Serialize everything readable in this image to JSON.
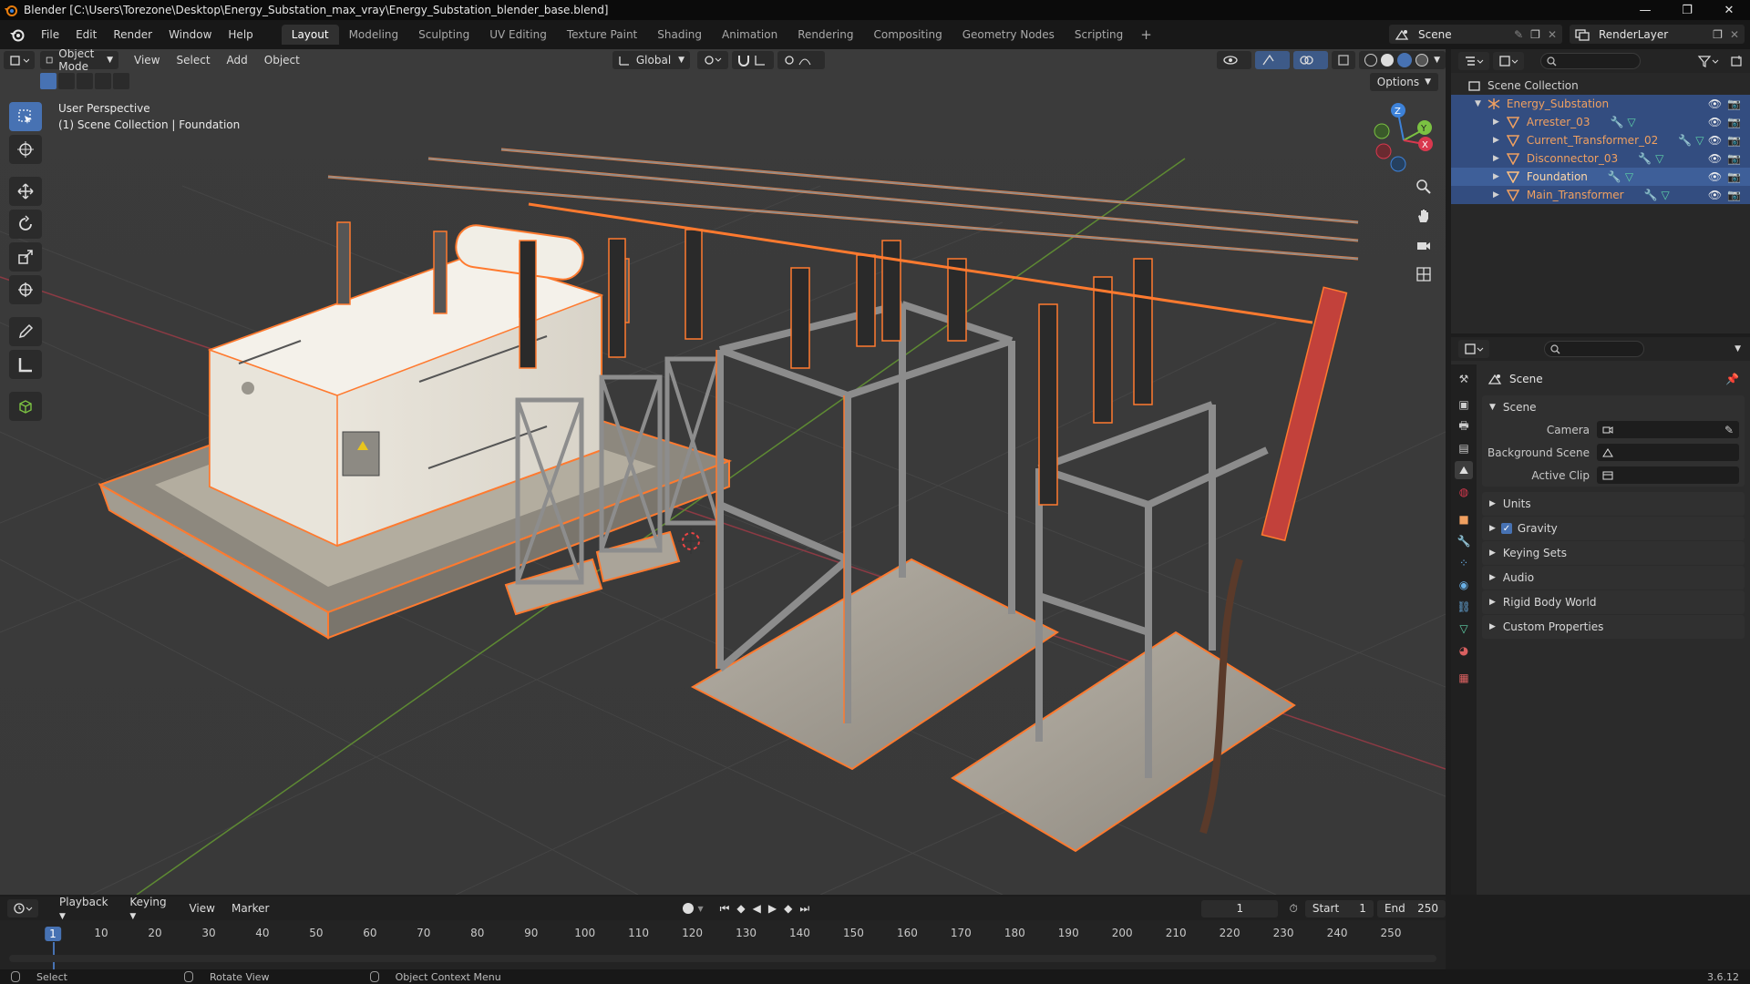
{
  "window": {
    "title": "Blender [C:\\Users\\Torezone\\Desktop\\Energy_Substation_max_vray\\Energy_Substation_blender_base.blend]",
    "controls": [
      "—",
      "❐",
      "✕"
    ]
  },
  "menubar": {
    "menus": [
      "File",
      "Edit",
      "Render",
      "Window",
      "Help"
    ],
    "workspaces": [
      "Layout",
      "Modeling",
      "Sculpting",
      "UV Editing",
      "Texture Paint",
      "Shading",
      "Animation",
      "Rendering",
      "Compositing",
      "Geometry Nodes",
      "Scripting"
    ],
    "active_workspace": "Layout",
    "add_workspace": "+",
    "scene_name": "Scene",
    "view_layer": "RenderLayer"
  },
  "viewport": {
    "mode": "Object Mode",
    "menus": [
      "View",
      "Select",
      "Add",
      "Object"
    ],
    "transform_orientation": "Global",
    "options_label": "Options",
    "perspective_label": "User Perspective",
    "collection_label": "(1) Scene Collection | Foundation",
    "gizmo_axes": {
      "x": "X",
      "y": "Y",
      "z": "Z"
    }
  },
  "colors": {
    "accent": "#4772b3",
    "selection_outline": "#ff7a2f",
    "active_outline": "#ffb070",
    "x_axis": "#d9384e",
    "y_axis": "#7bc142",
    "z_axis": "#3d82d9",
    "name_orange": "#f0a060",
    "grid": "#4a4a4a"
  },
  "outliner": {
    "root": "Scene Collection",
    "collection": "Energy_Substation",
    "items": [
      {
        "name": "Arrester_03",
        "selected": false
      },
      {
        "name": "Current_Transformer_02",
        "selected": false
      },
      {
        "name": "Disconnector_03",
        "selected": false
      },
      {
        "name": "Foundation",
        "selected": true
      },
      {
        "name": "Main_Transformer",
        "selected": false
      }
    ]
  },
  "properties": {
    "context_title": "Scene",
    "panel_title": "Scene",
    "fields": [
      {
        "label": "Camera",
        "value": ""
      },
      {
        "label": "Background Scene",
        "value": ""
      },
      {
        "label": "Active Clip",
        "value": ""
      }
    ],
    "subpanels": [
      {
        "label": "Units",
        "checkbox": false
      },
      {
        "label": "Gravity",
        "checkbox": true
      },
      {
        "label": "Keying Sets",
        "checkbox": false
      },
      {
        "label": "Audio",
        "checkbox": false
      },
      {
        "label": "Rigid Body World",
        "checkbox": false
      },
      {
        "label": "Custom Properties",
        "checkbox": false
      }
    ],
    "tab_icons": [
      "tool-icon",
      "render-icon",
      "output-icon",
      "view-layer-icon",
      "scene-icon",
      "world-icon",
      "object-icon",
      "modifier-icon",
      "particles-icon",
      "physics-icon",
      "constraints-icon",
      "data-icon",
      "material-icon",
      "texture-icon"
    ],
    "active_tab": "scene-icon"
  },
  "timeline": {
    "menus": [
      "Playback",
      "Keying",
      "View",
      "Marker"
    ],
    "current_frame": "1",
    "start_label": "Start",
    "start_value": "1",
    "end_label": "End",
    "end_value": "250",
    "frame_ticks": [
      "1",
      "10",
      "20",
      "30",
      "40",
      "50",
      "60",
      "70",
      "80",
      "90",
      "100",
      "110",
      "120",
      "130",
      "140",
      "150",
      "160",
      "170",
      "180",
      "190",
      "200",
      "210",
      "220",
      "230",
      "240",
      "250"
    ]
  },
  "statusbar": {
    "items": [
      "Select",
      "Rotate View",
      "Object Context Menu"
    ],
    "version": "3.6.12"
  }
}
